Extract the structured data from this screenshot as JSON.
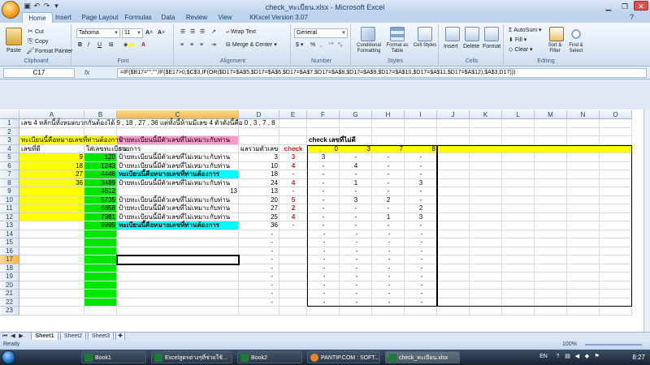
{
  "window": {
    "title": "check_ทะเบียน.xlsx - Microsoft Excel"
  },
  "ribbon": {
    "tabs": [
      "Home",
      "Insert",
      "Page Layout",
      "Formulas",
      "Data",
      "Review",
      "View",
      "KKxcel Version 3.07"
    ],
    "active_tab": "Home",
    "clipboard": {
      "paste": "Paste",
      "cut": "Cut",
      "copy": "Copy",
      "format_painter": "Format Painter",
      "label": "Clipboard"
    },
    "font": {
      "name": "Tahoma",
      "size": "11",
      "label": "Font"
    },
    "alignment": {
      "wrap_text": "Wrap Text",
      "merge_center": "Merge & Center",
      "label": "Alignment"
    },
    "number": {
      "format": "General",
      "label": "Number"
    },
    "styles": {
      "conditional": "Conditional Formatting",
      "format_table": "Format as Table",
      "cell_styles": "Cell Styles",
      "label": "Styles"
    },
    "cells": {
      "insert": "Insert",
      "delete": "Delete",
      "format": "Format",
      "label": "Cells"
    },
    "editing": {
      "autosum": "AutoSum",
      "fill": "Fill",
      "clear": "Clear",
      "sort_filter": "Sort & Filter",
      "find_select": "Find & Select",
      "label": "Editing"
    }
  },
  "formula_bar": {
    "name_box": "C17",
    "formula": "=IF($B17=\"\",\"\",IF($E17>0,$C$3,IF(OR($D17=$A$5,$D17=$A$6,$D17=$A$7,$D17=$A$8,$D17=$A$9,$D17=$A$10,$D17=$A$11,$D17=$A$12),$A$3,D17)))"
  },
  "columns": [
    "A",
    "B",
    "C",
    "D",
    "E",
    "F",
    "G",
    "H",
    "I",
    "J",
    "K",
    "L",
    "M",
    "N",
    "O"
  ],
  "rows": [
    "1",
    "2",
    "3",
    "4",
    "5",
    "6",
    "7",
    "8",
    "9",
    "10",
    "11",
    "12",
    "13",
    "14",
    "15",
    "16",
    "17",
    "18",
    "19",
    "20",
    "21",
    "22",
    "23"
  ],
  "cells": {
    "A1": "เลข 4 หลักนี้ทั้งหมดบวกกันต้องได้ 9 , 18 , 27 , 36 แต่ทั้งนี้ห้ามมีเลข 4 ตัวดังนี้คือ 0 , 3 , 7 , 8",
    "A3": "ทะเบียนนี้คือหมายเลขที่ท่านต้องการ",
    "C3": "ป้ายทะเบียนนี้มีตัวเลขที่ไม่เหมาะกับท่าน",
    "F3": "check เลขที่ไม่ดี",
    "A4": "เลขที่ดี",
    "B4": "ใส่เลขทะเบียน",
    "C4": "รายการ",
    "D4": "ผลรวมตัวเลข",
    "E4": "check",
    "F4": "0",
    "G4": "3",
    "H4": "7",
    "I4": "8",
    "A5": "9",
    "A6": "18",
    "A7": "27",
    "A8": "36",
    "B5": "120",
    "B6": "1243",
    "B7": "4446",
    "B8": "3489",
    "B9": "4612",
    "B10": "5735",
    "B11": "6858",
    "B12": "7981",
    "B13": "9999",
    "C5": "ป้ายทะเบียนนี้มีตัวเลขที่ไม่เหมาะกับท่าน",
    "C6": "ป้ายทะเบียนนี้มีตัวเลขที่ไม่เหมาะกับท่าน",
    "C7": "ทะเบียนนี้คือหมายเลขที่ท่านต้องการ",
    "C8": "ป้ายทะเบียนนี้มีตัวเลขที่ไม่เหมาะกับท่าน",
    "C9": "13",
    "C10": "ป้ายทะเบียนนี้มีตัวเลขที่ไม่เหมาะกับท่าน",
    "C11": "ป้ายทะเบียนนี้มีตัวเลขที่ไม่เหมาะกับท่าน",
    "C12": "ป้ายทะเบียนนี้มีตัวเลขที่ไม่เหมาะกับท่าน",
    "C13": "ทะเบียนนี้คือหมายเลขที่ท่านต้องการ",
    "D5": "3",
    "D6": "10",
    "D7": "18",
    "D8": "24",
    "D9": "13",
    "D10": "20",
    "D11": "27",
    "D12": "25",
    "D13": "36",
    "E5": "3",
    "E6": "4",
    "E7": "-",
    "E8": "4",
    "E9": "-",
    "E10": "5",
    "E11": "2",
    "E12": "4",
    "E13": "-",
    "F5": "3",
    "G5": "-",
    "H5": "-",
    "I5": "-",
    "F6": "-",
    "G6": "4",
    "H6": "-",
    "I6": "-",
    "F7": "-",
    "G7": "-",
    "H7": "-",
    "I7": "-",
    "F8": "-",
    "G8": "1",
    "H8": "-",
    "I8": "3",
    "F9": "-",
    "G9": "-",
    "H9": "-",
    "I9": "-",
    "F10": "-",
    "G10": "3",
    "H10": "2",
    "I10": "-",
    "F11": "-",
    "G11": "-",
    "H11": "-",
    "I11": "2",
    "F12": "-",
    "G12": "-",
    "H12": "1",
    "I12": "3",
    "F13": "-",
    "G13": "-",
    "H13": "-",
    "I13": "-",
    "dash": "-"
  },
  "sheets": [
    "Sheet1",
    "Sheet2",
    "Sheet3"
  ],
  "active_sheet": "Sheet1",
  "status": {
    "text": "Ready",
    "zoom": "100%"
  },
  "taskbar": {
    "items": [
      "Book1",
      "Excelสูตรต่างๆที่ช่วยใช้...",
      "Book2",
      "PANTIP.COM : SOFT...",
      "check_ทะเบียน.xlsx"
    ],
    "lang": "EN",
    "clock": "8:27"
  },
  "colors": {
    "yellow": "#ffff00",
    "green": "#00e400",
    "pink": "#ff99cc",
    "cyan": "#00ffff",
    "red": "#d81b1b",
    "selection": "#f2b84f"
  }
}
